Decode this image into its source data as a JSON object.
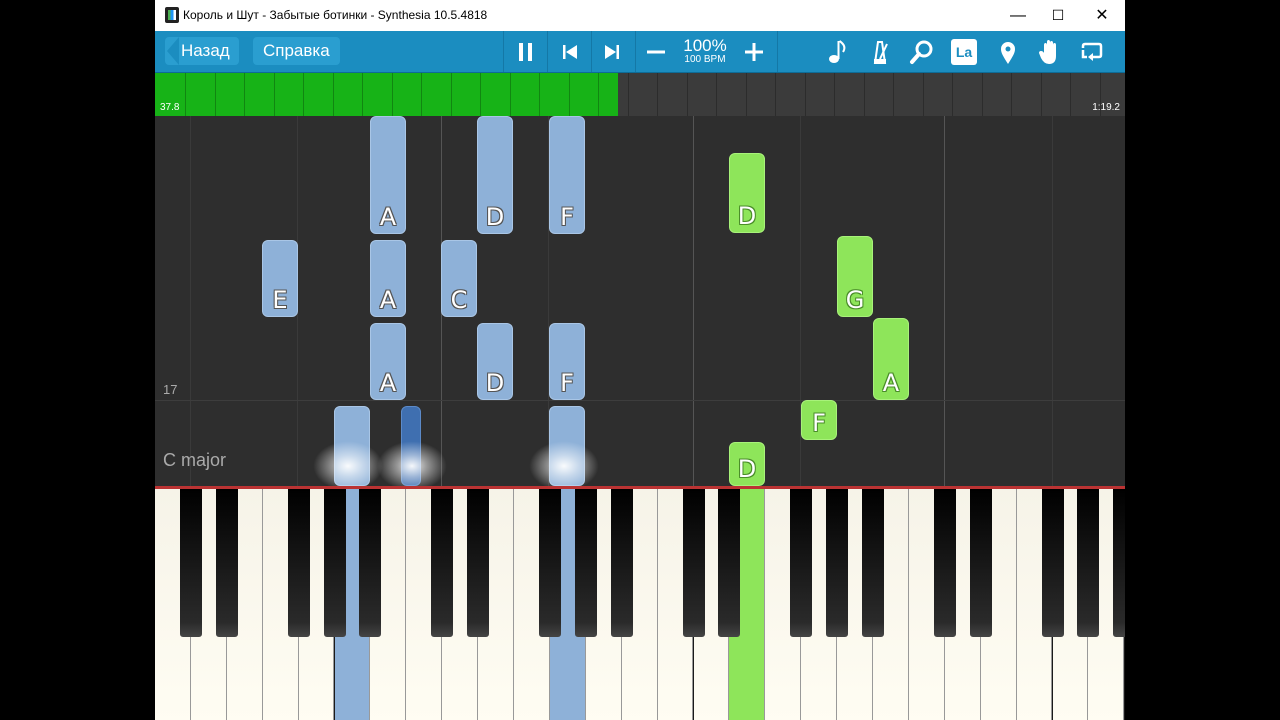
{
  "window": {
    "title": "Король и Шут - Забытые ботинки - Synthesia 10.5.4818",
    "controls": {
      "minimize": "—",
      "maximize": "☐",
      "close": "✕"
    }
  },
  "toolbar": {
    "back_label": "Назад",
    "help_label": "Справка",
    "speed_percent": "100%",
    "speed_bpm": "100 BPM",
    "icons": [
      "pause-icon",
      "skip-back-icon",
      "skip-forward-icon",
      "minus-icon",
      "plus-icon",
      "note-icon",
      "metronome-icon",
      "zoom-icon",
      "label-icon",
      "marker-icon",
      "hand-icon",
      "loop-icon"
    ],
    "label_icon_text": "La",
    "accent": "#1b8dc0"
  },
  "progress": {
    "elapsed": "37.8",
    "total": "1:19.2",
    "fraction": 0.477,
    "fill_color": "#17b317"
  },
  "roll": {
    "measure_number": "17",
    "key_signature": "C major",
    "notes": [
      {
        "label": "A",
        "color": "blue"
      },
      {
        "label": "D",
        "color": "blue"
      },
      {
        "label": "F",
        "color": "blue"
      },
      {
        "label": "D",
        "color": "green"
      },
      {
        "label": "E",
        "color": "blue"
      },
      {
        "label": "A",
        "color": "blue"
      },
      {
        "label": "C",
        "color": "blue"
      },
      {
        "label": "G",
        "color": "green"
      },
      {
        "label": "A",
        "color": "blue"
      },
      {
        "label": "D",
        "color": "blue"
      },
      {
        "label": "F",
        "color": "blue"
      },
      {
        "label": "A",
        "color": "green"
      },
      {
        "label": "F",
        "color": "green"
      },
      {
        "label": "D",
        "color": "green"
      }
    ],
    "colors": {
      "blue": "#8eb1d8",
      "dark_blue": "#3f6fb0",
      "green": "#8ee55a"
    }
  }
}
